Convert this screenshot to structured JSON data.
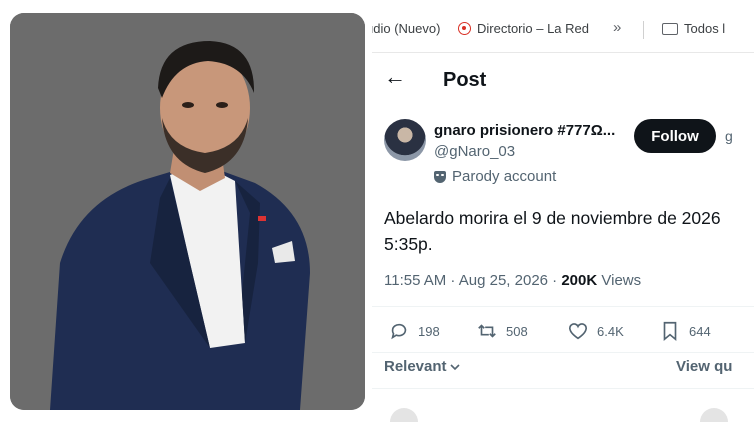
{
  "bookmarks": {
    "item1": "udio (Nuevo)",
    "item2": "Directorio – La Red",
    "more": "»",
    "item3": "Todos l"
  },
  "header": {
    "back": "←",
    "title": "Post"
  },
  "author": {
    "name": "gnaro prisionero #777Ω...",
    "handle": "@gNaro_03",
    "label": "Parody account",
    "follow": "Follow",
    "extra": "g"
  },
  "post": {
    "text": "Abelardo morira el 9 de noviembre de 2026 5:35p.",
    "time": "11:55 AM · Aug 25, 2026 · ",
    "views_count": "200K",
    "views_label": "Views"
  },
  "actions": {
    "replies": "198",
    "reposts": "508",
    "likes": "6.4K",
    "bookmarks": "644"
  },
  "replies": {
    "sort": "Relevant",
    "view_quotes": "View qu"
  },
  "colors": {
    "photo_bg": "#6b6b6b",
    "suit": "#1f2d52",
    "button_bg": "#0f1419",
    "muted": "#536471"
  },
  "icons": [
    "back-arrow-icon",
    "directory-icon",
    "folder-icon",
    "parody-mask-icon",
    "reply-icon",
    "repost-icon",
    "like-icon",
    "bookmark-icon",
    "chevron-down-icon"
  ]
}
